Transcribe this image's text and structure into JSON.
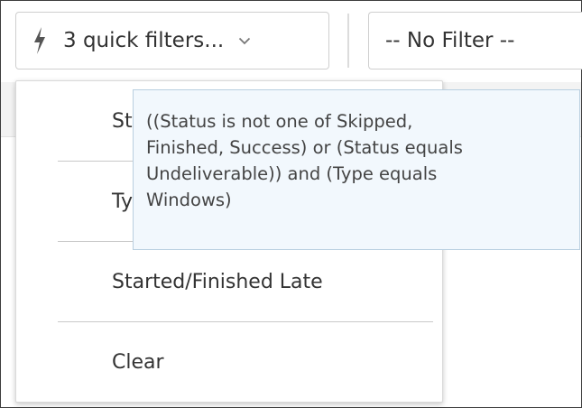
{
  "quick_filters": {
    "button_label": "3 quick filters...",
    "icons": {
      "bolt": "bolt-icon",
      "chevron": "chevron-down-icon"
    }
  },
  "filter_select": {
    "value": "-- No Filter --"
  },
  "menu": {
    "items": [
      {
        "label": "St"
      },
      {
        "label": "Ty"
      },
      {
        "label": "Started/Finished Late"
      },
      {
        "label": "Clear"
      }
    ]
  },
  "tooltip": {
    "lines": [
      "((Status is not one of Skipped,",
      "Finished, Success) or (Status equals",
      "Undeliverable)) and (Type equals",
      "Windows)"
    ]
  },
  "colors": {
    "tooltip_background": "#f2f8fd",
    "tooltip_border": "#b9cfe0",
    "text": "#333333"
  }
}
